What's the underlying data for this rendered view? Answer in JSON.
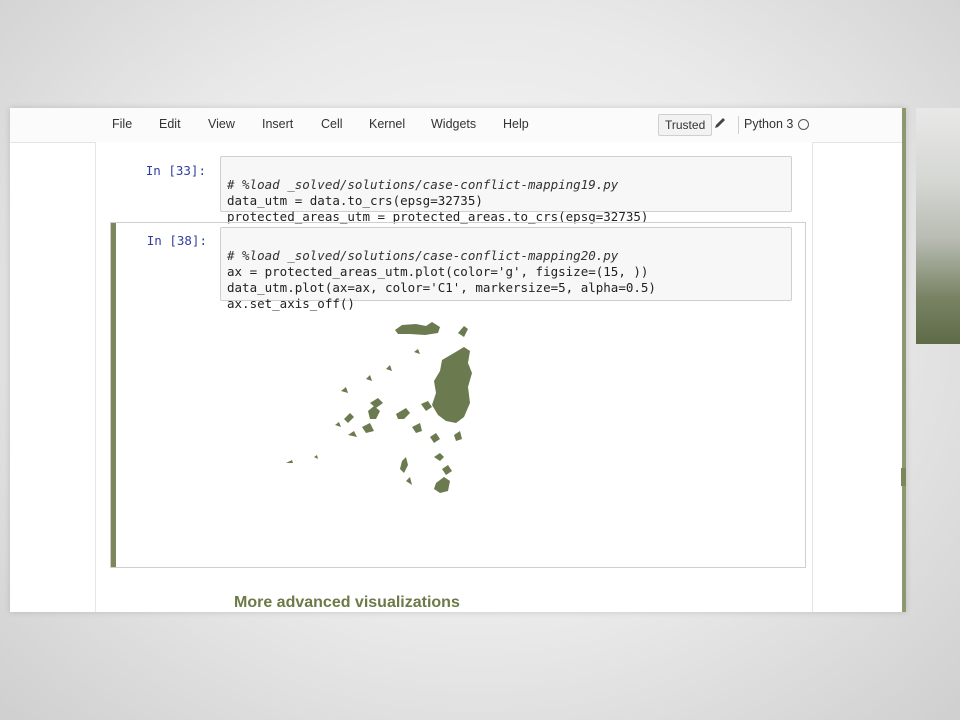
{
  "menu": {
    "items": [
      "File",
      "Edit",
      "View",
      "Insert",
      "Cell",
      "Kernel",
      "Widgets",
      "Help"
    ],
    "trusted_label": "Trusted",
    "kernel_name": "Python 3"
  },
  "cells": [
    {
      "prompt": "In [33]:",
      "lines": [
        "# %load _solved/solutions/case-conflict-mapping19.py",
        "data_utm = data.to_crs(epsg=32735)",
        "protected_areas_utm = protected_areas.to_crs(epsg=32735)"
      ]
    },
    {
      "prompt": "In [38]:",
      "lines": [
        "# %load _solved/solutions/case-conflict-mapping20.py",
        "ax = protected_areas_utm.plot(color='g', figsize=(15, ))",
        "data_utm.plot(ax=ax, color='C1', markersize=5, alpha=0.5)",
        "ax.set_axis_off()"
      ]
    }
  ],
  "output": {
    "description_color": "#6b7a4f"
  },
  "heading": "More advanced visualizations",
  "colors": {
    "accent": "#7c875c",
    "prompt": "#303f9f",
    "map_fill": "#6b7a4f"
  }
}
